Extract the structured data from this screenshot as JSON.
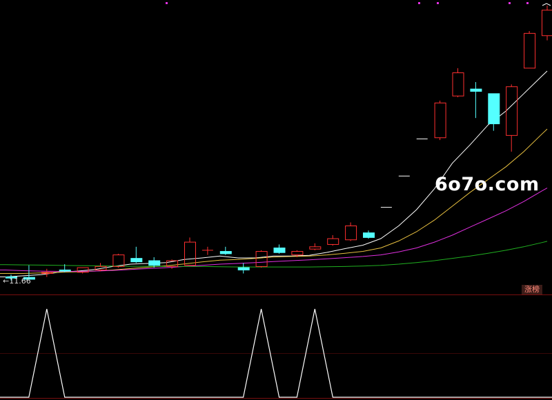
{
  "watermark": "6o7o.com",
  "low_price_label": "←11.66",
  "limit_up_badge": "涨榜",
  "colors": {
    "background": "#000000",
    "up": "#ff3030",
    "down": "#54ffff",
    "ma_white": "#ffffff",
    "ma_yellow": "#e8c040",
    "ma_magenta": "#e030e0",
    "ma_green": "#20b020",
    "divider": "#7a0e0e"
  },
  "chart_data": [
    {
      "type": "candlestick",
      "title": "",
      "xlabel": "",
      "ylabel": "",
      "ylim": [
        11.4,
        23.5
      ],
      "low_marker": 11.66,
      "candles": [
        {
          "o": 11.8,
          "h": 11.9,
          "l": 11.65,
          "c": 11.75
        },
        {
          "o": 11.78,
          "h": 12.3,
          "l": 11.7,
          "c": 11.7
        },
        {
          "o": 11.95,
          "h": 12.15,
          "l": 11.8,
          "c": 12.0
        },
        {
          "o": 12.1,
          "h": 12.35,
          "l": 12.0,
          "c": 12.05
        },
        {
          "o": 12.0,
          "h": 12.2,
          "l": 11.95,
          "c": 12.2
        },
        {
          "o": 12.1,
          "h": 12.4,
          "l": 12.05,
          "c": 12.25
        },
        {
          "o": 12.25,
          "h": 12.8,
          "l": 12.2,
          "c": 12.75
        },
        {
          "o": 12.6,
          "h": 13.1,
          "l": 12.4,
          "c": 12.45
        },
        {
          "o": 12.5,
          "h": 12.65,
          "l": 12.2,
          "c": 12.3
        },
        {
          "o": 12.25,
          "h": 12.55,
          "l": 12.15,
          "c": 12.5
        },
        {
          "o": 12.3,
          "h": 13.5,
          "l": 12.3,
          "c": 13.3
        },
        {
          "o": 12.95,
          "h": 13.1,
          "l": 12.75,
          "c": 12.95
        },
        {
          "o": 12.9,
          "h": 13.1,
          "l": 12.75,
          "c": 12.8
        },
        {
          "o": 12.2,
          "h": 12.4,
          "l": 11.95,
          "c": 12.1
        },
        {
          "o": 12.25,
          "h": 12.95,
          "l": 12.2,
          "c": 12.9
        },
        {
          "o": 13.05,
          "h": 13.2,
          "l": 12.8,
          "c": 12.85
        },
        {
          "o": 12.75,
          "h": 12.95,
          "l": 12.65,
          "c": 12.9
        },
        {
          "o": 13.0,
          "h": 13.25,
          "l": 12.95,
          "c": 13.1
        },
        {
          "o": 13.2,
          "h": 13.6,
          "l": 13.15,
          "c": 13.45
        },
        {
          "o": 13.4,
          "h": 14.15,
          "l": 13.35,
          "c": 14.0
        },
        {
          "o": 13.7,
          "h": 13.8,
          "l": 13.45,
          "c": 13.5
        },
        {
          "o": 14.8,
          "h": 14.8,
          "l": 14.8,
          "c": 14.8
        },
        {
          "o": 16.15,
          "h": 16.15,
          "l": 16.15,
          "c": 16.15
        },
        {
          "o": 17.75,
          "h": 17.75,
          "l": 17.75,
          "c": 17.75
        },
        {
          "o": 17.8,
          "h": 19.4,
          "l": 17.7,
          "c": 19.3
        },
        {
          "o": 19.6,
          "h": 20.8,
          "l": 19.55,
          "c": 20.6
        },
        {
          "o": 19.9,
          "h": 20.2,
          "l": 18.65,
          "c": 19.8
        },
        {
          "o": 19.7,
          "h": 19.7,
          "l": 18.1,
          "c": 18.4
        },
        {
          "o": 17.9,
          "h": 20.1,
          "l": 17.2,
          "c": 20.0
        },
        {
          "o": 20.8,
          "h": 22.4,
          "l": 20.8,
          "c": 22.3
        },
        {
          "o": 22.2,
          "h": 23.5,
          "l": 22.0,
          "c": 23.3
        }
      ],
      "moving_averages": [
        {
          "color": "#ffffff",
          "values": [
            11.8,
            11.85,
            11.9,
            12.0,
            12.05,
            12.12,
            12.25,
            12.35,
            12.38,
            12.42,
            12.55,
            12.62,
            12.7,
            12.62,
            12.62,
            12.7,
            12.7,
            12.73,
            12.86,
            13.02,
            13.17,
            13.45,
            14.0,
            14.7,
            15.6,
            16.7,
            17.5,
            18.35,
            18.95,
            19.7,
            20.45
          ]
        },
        {
          "color": "#e8c040",
          "values": [
            11.95,
            11.95,
            11.97,
            12.0,
            12.02,
            12.05,
            12.1,
            12.16,
            12.22,
            12.28,
            12.36,
            12.45,
            12.52,
            12.55,
            12.6,
            12.66,
            12.68,
            12.7,
            12.75,
            12.82,
            12.9,
            13.05,
            13.35,
            13.75,
            14.25,
            14.85,
            15.45,
            16.0,
            16.55,
            17.2,
            17.95
          ]
        },
        {
          "color": "#e030e0",
          "values": [
            12.1,
            12.07,
            12.05,
            12.04,
            12.04,
            12.05,
            12.08,
            12.12,
            12.16,
            12.2,
            12.25,
            12.3,
            12.35,
            12.38,
            12.42,
            12.46,
            12.5,
            12.54,
            12.58,
            12.63,
            12.68,
            12.75,
            12.88,
            13.05,
            13.3,
            13.6,
            13.95,
            14.3,
            14.65,
            15.05,
            15.5
          ]
        },
        {
          "color": "#20b020",
          "values": [
            12.33,
            12.32,
            12.31,
            12.3,
            12.29,
            12.28,
            12.27,
            12.26,
            12.26,
            12.25,
            12.25,
            12.25,
            12.24,
            12.23,
            12.23,
            12.23,
            12.23,
            12.23,
            12.24,
            12.25,
            12.27,
            12.3,
            12.35,
            12.42,
            12.5,
            12.6,
            12.7,
            12.82,
            12.95,
            13.1,
            13.28
          ]
        }
      ]
    },
    {
      "type": "line",
      "title": "",
      "xlabel": "",
      "ylabel": "",
      "ylim": [
        0,
        1
      ],
      "series": [
        {
          "color": "#ffffff",
          "values": [
            0,
            0,
            1,
            0,
            0,
            0,
            0,
            0,
            0,
            0,
            0,
            0,
            0,
            0,
            1,
            0,
            0,
            1,
            0,
            0,
            0,
            0,
            0,
            0,
            0,
            0,
            0,
            0,
            0,
            0,
            0
          ]
        }
      ]
    }
  ]
}
